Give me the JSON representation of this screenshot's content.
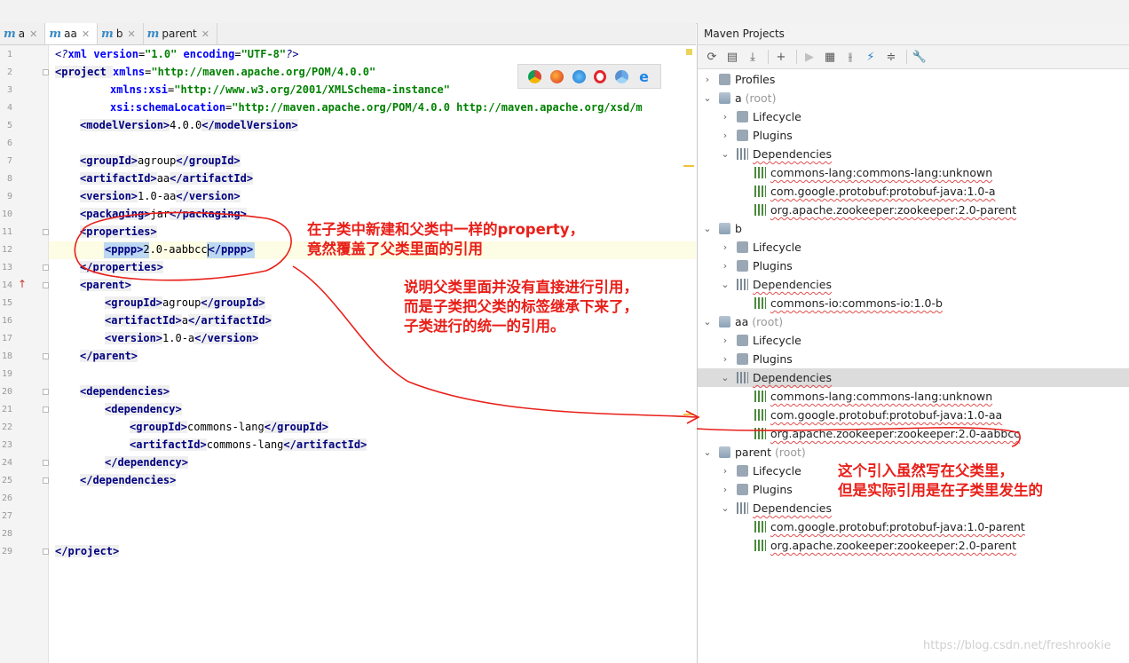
{
  "tabs": [
    {
      "label": "a",
      "active": false
    },
    {
      "label": "aa",
      "active": true
    },
    {
      "label": "b",
      "active": false
    },
    {
      "label": "parent",
      "active": false
    }
  ],
  "editor": {
    "line_numbers": [
      "1",
      "2",
      "3",
      "4",
      "5",
      "6",
      "7",
      "8",
      "9",
      "10",
      "11",
      "12",
      "13",
      "14",
      "15",
      "16",
      "17",
      "18",
      "19",
      "20",
      "21",
      "22",
      "23",
      "24",
      "25",
      "26",
      "27",
      "28",
      "29"
    ],
    "l1": {
      "a": "<?",
      "b": "xml ",
      "c": "version",
      "d": "=",
      "e": "\"1.0\"",
      "f": " encoding",
      "g": "=",
      "h": "\"UTF-8\"",
      "i": "?>"
    },
    "l2": {
      "a": "<project ",
      "b": "xmlns",
      "c": "=",
      "d": "\"http://maven.apache.org/POM/4.0.0\""
    },
    "l3": {
      "a": "xmlns:xsi",
      "b": "=",
      "c": "\"http://www.w3.org/2001/XMLSchema-instance\""
    },
    "l4": {
      "a": "xsi:schemaLocation",
      "b": "=",
      "c": "\"http://maven.apache.org/POM/4.0.0 http://maven.apache.org/xsd/m"
    },
    "l5": {
      "open": "<modelVersion>",
      "text": "4.0.0",
      "close": "</modelVersion>"
    },
    "l7": {
      "open": "<groupId>",
      "text": "agroup",
      "close": "</groupId>"
    },
    "l8": {
      "open": "<artifactId>",
      "text": "aa",
      "close": "</artifactId>"
    },
    "l9": {
      "open": "<version>",
      "text": "1.0-aa",
      "close": "</version>"
    },
    "l10": {
      "open": "<packaging>",
      "text": "jar",
      "close": "</packaging>"
    },
    "l11": {
      "open": "<properties>"
    },
    "l12": {
      "open": "<pppp>",
      "text": "2.0-aabbcc",
      "close": "</pppp>"
    },
    "l13": {
      "close": "</properties>"
    },
    "l14": {
      "open": "<parent>"
    },
    "l15": {
      "open": "<groupId>",
      "text": "agroup",
      "close": "</groupId>"
    },
    "l16": {
      "open": "<artifactId>",
      "text": "a",
      "close": "</artifactId>"
    },
    "l17": {
      "open": "<version>",
      "text": "1.0-a",
      "close": "</version>"
    },
    "l18": {
      "close": "</parent>"
    },
    "l20": {
      "open": "<dependencies>"
    },
    "l21": {
      "open": "<dependency>"
    },
    "l22": {
      "open": "<groupId>",
      "text": "commons-lang",
      "close": "</groupId>"
    },
    "l23": {
      "open": "<artifactId>",
      "text": "commons-lang",
      "close": "</artifactId>"
    },
    "l24": {
      "close": "</dependency>"
    },
    "l25": {
      "close": "</dependencies>"
    },
    "l29": {
      "close": "</project>"
    }
  },
  "browsers": [
    "chrome-icon",
    "firefox-icon",
    "safari-icon",
    "opera-icon",
    "chromium-icon",
    "edge-icon"
  ],
  "maven": {
    "title": "Maven Projects",
    "toolbar_icons": [
      "refresh-icon",
      "reimport-icon",
      "download-icon",
      "add-icon",
      "run-icon",
      "lifecycle-icon",
      "toggle-offline-icon",
      "skip-tests-icon",
      "collapse-icon",
      "settings-icon"
    ],
    "tree": [
      {
        "label": "Profiles",
        "indent": 0,
        "arrow": "›",
        "icon": "folder"
      },
      {
        "label": "a",
        "suffix": " (root)",
        "indent": 0,
        "arrow": "⌄",
        "icon": "module"
      },
      {
        "label": "Lifecycle",
        "indent": 1,
        "arrow": "›",
        "icon": "folder"
      },
      {
        "label": "Plugins",
        "indent": 1,
        "arrow": "›",
        "icon": "folder"
      },
      {
        "label": "Dependencies",
        "indent": 1,
        "arrow": "⌄",
        "icon": "deps",
        "wave": true
      },
      {
        "label": "commons-lang:commons-lang:unknown",
        "indent": 2,
        "icon": "lib",
        "wave": true
      },
      {
        "label": "com.google.protobuf:protobuf-java:1.0-a",
        "indent": 2,
        "icon": "lib",
        "wave": true
      },
      {
        "label": "org.apache.zookeeper:zookeeper:2.0-parent",
        "indent": 2,
        "icon": "lib",
        "wave": true
      },
      {
        "label": "b",
        "indent": 0,
        "arrow": "⌄",
        "icon": "module"
      },
      {
        "label": "Lifecycle",
        "indent": 1,
        "arrow": "›",
        "icon": "folder"
      },
      {
        "label": "Plugins",
        "indent": 1,
        "arrow": "›",
        "icon": "folder"
      },
      {
        "label": "Dependencies",
        "indent": 1,
        "arrow": "⌄",
        "icon": "deps",
        "wave": true
      },
      {
        "label": "commons-io:commons-io:1.0-b",
        "indent": 2,
        "icon": "lib",
        "wave": true
      },
      {
        "label": "aa",
        "suffix": " (root)",
        "indent": 0,
        "arrow": "⌄",
        "icon": "module"
      },
      {
        "label": "Lifecycle",
        "indent": 1,
        "arrow": "›",
        "icon": "folder"
      },
      {
        "label": "Plugins",
        "indent": 1,
        "arrow": "›",
        "icon": "folder"
      },
      {
        "label": "Dependencies",
        "indent": 1,
        "arrow": "⌄",
        "icon": "deps",
        "wave": true,
        "selected": true
      },
      {
        "label": "commons-lang:commons-lang:unknown",
        "indent": 2,
        "icon": "lib",
        "wave": true
      },
      {
        "label": "com.google.protobuf:protobuf-java:1.0-aa",
        "indent": 2,
        "icon": "lib",
        "wave": true
      },
      {
        "label": "org.apache.zookeeper:zookeeper:2.0-aabbcc",
        "indent": 2,
        "icon": "lib",
        "wave": true
      },
      {
        "label": "parent",
        "suffix": " (root)",
        "indent": 0,
        "arrow": "⌄",
        "icon": "module"
      },
      {
        "label": "Lifecycle",
        "indent": 1,
        "arrow": "›",
        "icon": "folder"
      },
      {
        "label": "Plugins",
        "indent": 1,
        "arrow": "›",
        "icon": "folder"
      },
      {
        "label": "Dependencies",
        "indent": 1,
        "arrow": "⌄",
        "icon": "deps",
        "wave": true
      },
      {
        "label": "com.google.protobuf:protobuf-java:1.0-parent",
        "indent": 2,
        "icon": "lib",
        "wave": true
      },
      {
        "label": "org.apache.zookeeper:zookeeper:2.0-parent",
        "indent": 2,
        "icon": "lib",
        "wave": true
      }
    ]
  },
  "annotations": {
    "a1_line1": "在子类中新建和父类中一样的property，",
    "a1_line2": "竟然覆盖了父类里面的引用",
    "a2_line1": "说明父类里面并没有直接进行引用，",
    "a2_line2": "而是子类把父类的标签继承下来了，",
    "a2_line3": "子类进行的统一的引用。",
    "a3_line1": "这个引入虽然写在父类里，",
    "a3_line2": "但是实际引用是在子类里发生的"
  },
  "watermark": "https://blog.csdn.net/freshrookie",
  "colors": {
    "annotation": "#e8201a",
    "tag": "#000080",
    "attr_value": "#008000",
    "attr_name": "#0000ff"
  }
}
